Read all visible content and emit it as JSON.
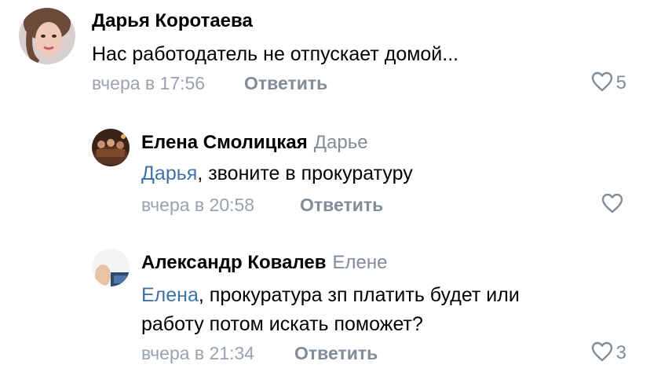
{
  "comments": [
    {
      "author": "Дарья Коротаева",
      "reply_to": "",
      "mention": "",
      "text_lines": [
        "Нас работодатель не отпускает домой..."
      ],
      "time": "вчера в 17:56",
      "reply_label": "Ответить",
      "likes": "5"
    },
    {
      "author": "Елена Смолицкая",
      "reply_to": "Дарье",
      "mention": "Дарья",
      "text_lines": [
        ", звоните в прокуратуру"
      ],
      "time": "вчера в 20:58",
      "reply_label": "Ответить",
      "likes": ""
    },
    {
      "author": "Александр Ковалев",
      "reply_to": "Елене",
      "mention": "Елена",
      "text_lines": [
        ", прокуратура зп платить будет или",
        "работу потом искать поможет?"
      ],
      "time": "вчера в 21:34",
      "reply_label": "Ответить",
      "likes": "3"
    }
  ],
  "colors": {
    "link": "#3f72a8",
    "secondary": "#818c99",
    "meta": "#99a2ad"
  },
  "icons": {
    "like": "heart-outline-icon"
  }
}
